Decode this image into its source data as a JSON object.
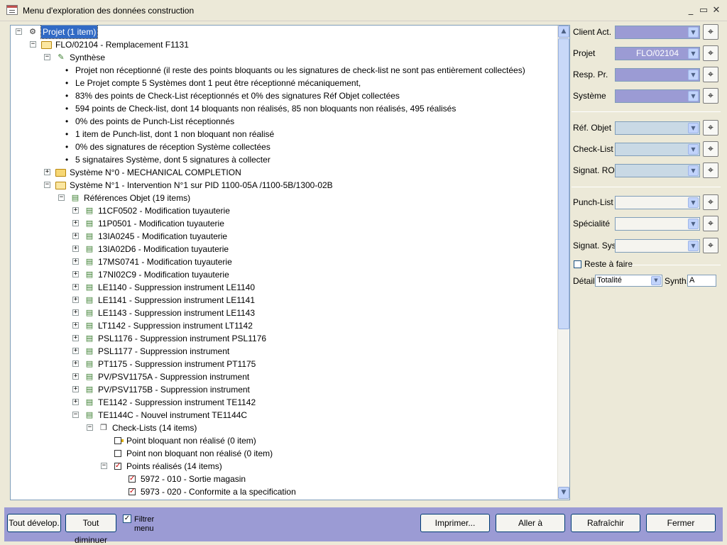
{
  "window": {
    "title": "Menu d'exploration des données construction",
    "minimize": "_",
    "restore": "▭",
    "close": "✕"
  },
  "tree": {
    "rows": [
      {
        "indent": 0,
        "toggle": "−",
        "icon": "network-icon",
        "label": "Projet (1 item)",
        "selected": true
      },
      {
        "indent": 1,
        "toggle": "−",
        "icon": "folder-open-icon",
        "label": "FLO/02104 - Remplacement F1131"
      },
      {
        "indent": 2,
        "toggle": "−",
        "icon": "synthesis-icon",
        "label": "Synthèse"
      },
      {
        "indent": 3,
        "bullet": true,
        "label": "Projet non réceptionné (il reste des points bloquants ou les signatures de check-list ne sont pas entièrement collectées)"
      },
      {
        "indent": 3,
        "bullet": true,
        "label": "Le Projet compte 5 Systèmes dont 1 peut être réceptionné mécaniquement,"
      },
      {
        "indent": 3,
        "bullet": true,
        "label": "83% des points de Check-List réceptionnés et 0% des signatures Réf Objet collectées"
      },
      {
        "indent": 3,
        "bullet": true,
        "label": "594 points de Check-list, dont 14 bloquants non réalisés, 85 non bloquants non réalisés, 495 réalisés"
      },
      {
        "indent": 3,
        "bullet": true,
        "label": "0% des points de Punch-List réceptionnés"
      },
      {
        "indent": 3,
        "bullet": true,
        "label": "1 item de Punch-list, dont 1 non bloquant non réalisé"
      },
      {
        "indent": 3,
        "bullet": true,
        "label": "0% des signatures de réception Système collectées"
      },
      {
        "indent": 3,
        "bullet": true,
        "label": "5 signataires Système, dont 5 signatures à collecter"
      },
      {
        "indent": 2,
        "toggle": "+",
        "icon": "folder-icon",
        "label": "Système N°0 - MECHANICAL COMPLETION"
      },
      {
        "indent": 2,
        "toggle": "−",
        "icon": "folder-open-icon",
        "label": "Système N°1 - Intervention N°1 sur PID 1100-05A /1100-5B/1300-02B"
      },
      {
        "indent": 3,
        "toggle": "−",
        "icon": "object-ref-icon",
        "label": "Références Objet (19 items)"
      },
      {
        "indent": 4,
        "toggle": "+",
        "icon": "object-ref-icon",
        "label": "11CF0502 - Modification  tuyauterie"
      },
      {
        "indent": 4,
        "toggle": "+",
        "icon": "object-ref-icon",
        "label": "11P0501 - Modification  tuyauterie"
      },
      {
        "indent": 4,
        "toggle": "+",
        "icon": "object-ref-icon",
        "label": "13IA0245 - Modification tuyauterie"
      },
      {
        "indent": 4,
        "toggle": "+",
        "icon": "object-ref-icon",
        "label": "13IA02D6 - Modification  tuyauterie"
      },
      {
        "indent": 4,
        "toggle": "+",
        "icon": "object-ref-icon",
        "label": "17MS0741 - Modification  tuyauterie"
      },
      {
        "indent": 4,
        "toggle": "+",
        "icon": "object-ref-icon",
        "label": "17NI02C9 - Modification  tuyauterie"
      },
      {
        "indent": 4,
        "toggle": "+",
        "icon": "object-ref-icon",
        "label": "LE1140 - Suppression instrument LE1140"
      },
      {
        "indent": 4,
        "toggle": "+",
        "icon": "object-ref-icon",
        "label": "LE1141 - Suppression instrument LE1141"
      },
      {
        "indent": 4,
        "toggle": "+",
        "icon": "object-ref-icon",
        "label": "LE1143 - Suppression instrument LE1143"
      },
      {
        "indent": 4,
        "toggle": "+",
        "icon": "object-ref-icon",
        "label": "LT1142 - Suppression instrument LT1142"
      },
      {
        "indent": 4,
        "toggle": "+",
        "icon": "object-ref-icon",
        "label": "PSL1176 - Suppression instrument PSL1176"
      },
      {
        "indent": 4,
        "toggle": "+",
        "icon": "object-ref-icon",
        "label": "PSL1177 - Suppression instrument"
      },
      {
        "indent": 4,
        "toggle": "+",
        "icon": "object-ref-icon",
        "label": "PT1175 - Suppression instrument PT1175"
      },
      {
        "indent": 4,
        "toggle": "+",
        "icon": "object-ref-icon",
        "label": "PV/PSV1175A - Suppression instrument"
      },
      {
        "indent": 4,
        "toggle": "+",
        "icon": "object-ref-icon",
        "label": "PV/PSV1175B - Suppression instrument"
      },
      {
        "indent": 4,
        "toggle": "+",
        "icon": "object-ref-icon",
        "label": "TE1142 - Suppression instrument TE1142"
      },
      {
        "indent": 4,
        "toggle": "−",
        "icon": "object-ref-icon",
        "label": "TE1144C - Nouvel instrument TE1144C"
      },
      {
        "indent": 5,
        "toggle": "−",
        "icon": "checklist-icon",
        "label": "Check-Lists (14 items)"
      },
      {
        "indent": 6,
        "icon": "blocking-point-icon",
        "label": "Point bloquant non réalisé (0 item)"
      },
      {
        "indent": 6,
        "icon": "empty-checkbox-icon",
        "label": "Point non bloquant non réalisé (0 item)"
      },
      {
        "indent": 6,
        "toggle": "−",
        "icon": "checked-box-icon",
        "label": "Points réalisés (14 items)"
      },
      {
        "indent": 7,
        "icon": "checked-box-icon",
        "label": "5972 - 010 - Sortie magasin"
      },
      {
        "indent": 7,
        "icon": "checked-box-icon",
        "label": "5973 - 020 - Conformite a la specification"
      }
    ]
  },
  "filters": {
    "client_act": {
      "label": "Client Act.",
      "value": ""
    },
    "projet": {
      "label": "Projet",
      "value": "FLO/02104"
    },
    "resp_pr": {
      "label": "Resp. Pr.",
      "value": ""
    },
    "systeme": {
      "label": "Système",
      "value": ""
    },
    "ref_objet": {
      "label": "Réf. Objet",
      "value": ""
    },
    "check_list": {
      "label": "Check-List",
      "value": ""
    },
    "signat_ro": {
      "label": "Signat. RO",
      "value": ""
    },
    "punch_list": {
      "label": "Punch-List",
      "value": ""
    },
    "specialite": {
      "label": "Spécialité",
      "value": ""
    },
    "signat_sys": {
      "label": "Signat. Sys.",
      "value": ""
    },
    "reste_a_faire": "Reste à faire",
    "detail_label": "Détail",
    "detail_value": "Totalité",
    "synth_label": "Synth.",
    "synth_value": "A"
  },
  "buttons": {
    "expand_all": "Tout dévelop.",
    "collapse_all": "Tout diminuer",
    "filter_menu": "Filtrer menu",
    "print": "Imprimer...",
    "goto": "Aller à",
    "refresh": "Rafraîchir",
    "close": "Fermer"
  },
  "colors": {
    "filled_filter": "#9b9bd4",
    "ro_filter": "#c9d9e5",
    "footer": "#9b9bd4"
  }
}
